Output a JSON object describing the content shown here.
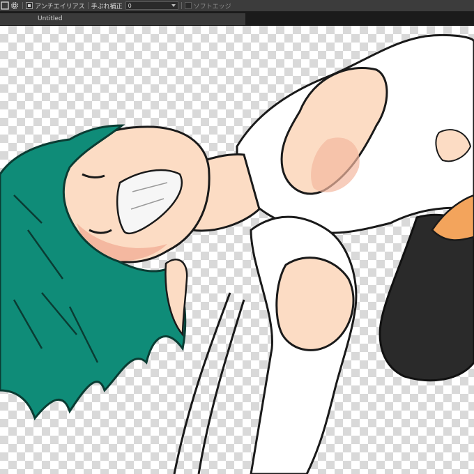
{
  "toolbar": {
    "icons": [
      "selection-icon",
      "gear-icon"
    ],
    "antialias_label": "アンチエイリアス",
    "antialias_checked": true,
    "stabilizer_label": "手ぶれ補正",
    "stabilizer_value": "0",
    "soft_edge_label": "ソフトエッジ",
    "soft_edge_checked": false
  },
  "document_tab": {
    "title": "Untitled"
  },
  "colors": {
    "toolbar_bg": "#3c3c3c",
    "tab_bg": "#3a3a3a",
    "hair": "#0f8c78",
    "skin": "#fcdcc4",
    "skin_shadow": "#f4b8a0",
    "jacket": "#2a2a2a",
    "line": "#1a1a1a"
  }
}
